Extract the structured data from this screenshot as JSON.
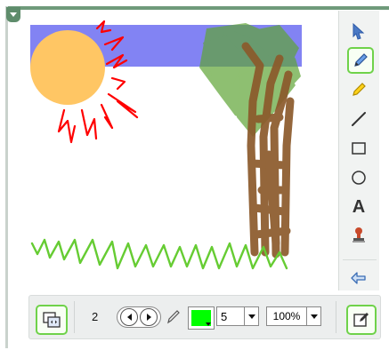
{
  "colors": {
    "active_border": "#6fd24a",
    "pen_color": "#00ff00",
    "sky": "#7b7cf2",
    "sun": "#ffc664",
    "sun_rays": "#ff0000",
    "grass": "#66cc33",
    "trunk": "#8b5a2b",
    "foliage": "#5fa536"
  },
  "side_toolbar": {
    "tools": [
      {
        "icon": "select-arrow-icon",
        "active": false
      },
      {
        "icon": "pen-icon",
        "active": true
      },
      {
        "icon": "highlighter-icon",
        "active": false
      },
      {
        "icon": "line-icon",
        "active": false
      },
      {
        "icon": "rectangle-icon",
        "active": false
      },
      {
        "icon": "ellipse-icon",
        "active": false
      },
      {
        "icon": "text-icon",
        "label": "A",
        "active": false
      },
      {
        "icon": "stamp-icon",
        "active": false
      },
      {
        "icon": "undo-icon",
        "active": false
      }
    ]
  },
  "bottom_toolbar": {
    "page_number": "2",
    "pen_size": "5",
    "zoom": "100%"
  }
}
